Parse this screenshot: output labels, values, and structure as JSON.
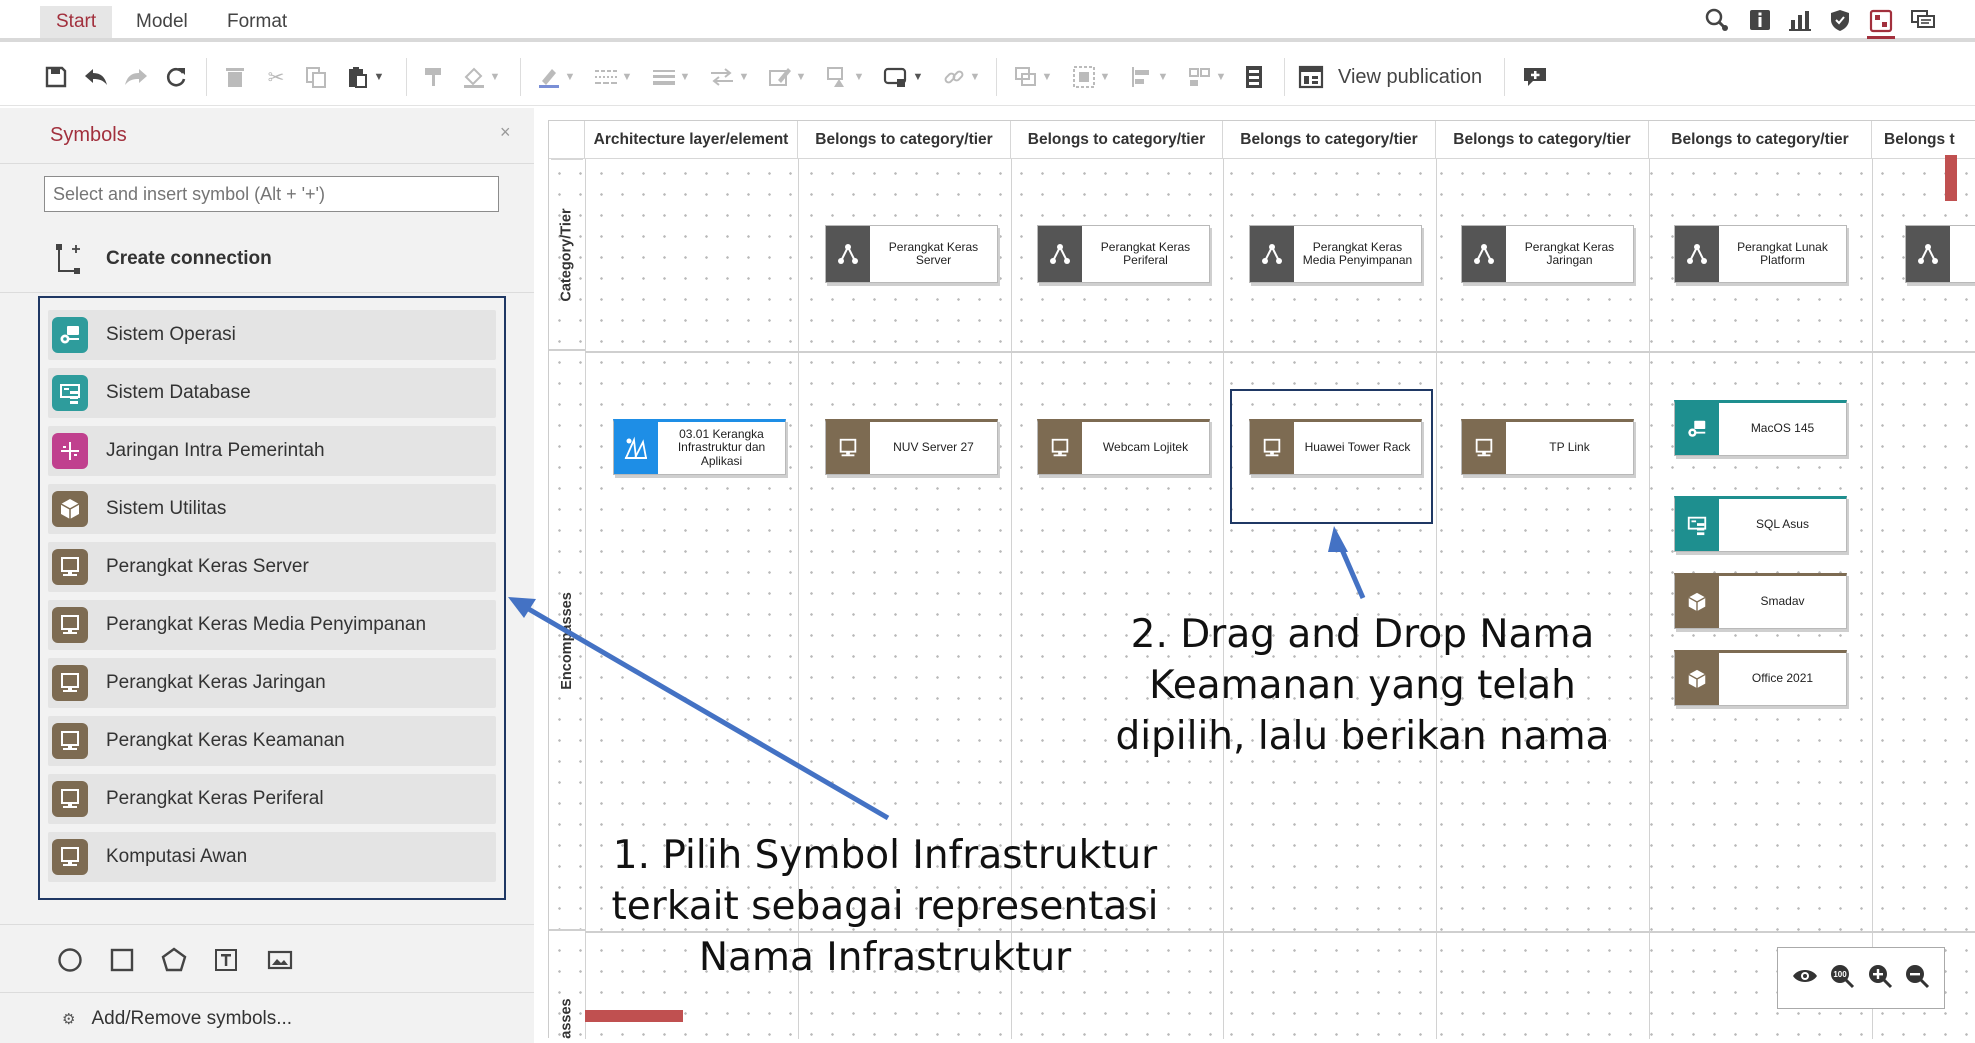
{
  "menubar": {
    "tabs": [
      {
        "label": "Start",
        "active": true
      },
      {
        "label": "Model",
        "active": false
      },
      {
        "label": "Format",
        "active": false
      }
    ],
    "right_icons": [
      "search-settings-icon",
      "info-icon",
      "bar-chart-icon",
      "shield-icon",
      "symbols-panel-icon",
      "comments-icon"
    ]
  },
  "toolbar": {
    "view_publication_label": "View publication"
  },
  "symbols_panel": {
    "title": "Symbols",
    "close_glyph": "×",
    "search_placeholder": "Select and insert symbol (Alt + '+')",
    "create_connection_label": "Create connection",
    "items": [
      {
        "label": "Sistem Operasi",
        "icon": "operating-system-icon",
        "color": "#2e9c9c"
      },
      {
        "label": "Sistem Database",
        "icon": "database-system-icon",
        "color": "#2e9c9c"
      },
      {
        "label": "Jaringan Intra Pemerintah",
        "icon": "network-icon",
        "color": "#c0408e"
      },
      {
        "label": "Sistem Utilitas",
        "icon": "utility-cube-icon",
        "color": "#7d6b52"
      },
      {
        "label": "Perangkat Keras Server",
        "icon": "monitor-icon",
        "color": "#7d6b52"
      },
      {
        "label": "Perangkat Keras Media Penyimpanan",
        "icon": "monitor-icon",
        "color": "#7d6b52"
      },
      {
        "label": "Perangkat Keras Jaringan",
        "icon": "monitor-icon",
        "color": "#7d6b52"
      },
      {
        "label": "Perangkat Keras Keamanan",
        "icon": "monitor-icon",
        "color": "#7d6b52"
      },
      {
        "label": "Perangkat Keras Periferal",
        "icon": "monitor-icon",
        "color": "#7d6b52"
      },
      {
        "label": "Komputasi Awan",
        "icon": "monitor-icon",
        "color": "#7d6b52"
      }
    ],
    "shape_icons": [
      "circle-shape-icon",
      "square-shape-icon",
      "pentagon-shape-icon",
      "text-shape-icon",
      "image-shape-icon"
    ],
    "add_remove_label": "Add/Remove symbols..."
  },
  "canvas": {
    "column_headers": [
      "Architecture layer/element",
      "Belongs to category/tier",
      "Belongs to category/tier",
      "Belongs to category/tier",
      "Belongs to category/tier",
      "Belongs to category/tier",
      "Belongs t"
    ],
    "row_labels": [
      "Category/Tier",
      "Encompasses",
      "passes"
    ],
    "category_nodes": [
      "Perangkat Keras Server",
      "Perangkat Keras Periferal",
      "Perangkat Keras Media Penyimpanan",
      "Perangkat Keras Jaringan",
      "Perangkat Lunak Platform"
    ],
    "element_nodes": [
      {
        "label": "03.01 Kerangka Infrastruktur dan Aplikasi",
        "color": "#1e8ee6"
      },
      {
        "label": "NUV Server 27",
        "color": "#7d6b52"
      },
      {
        "label": "Webcam Lojitek",
        "color": "#7d6b52"
      },
      {
        "label": "Huawei Tower Rack",
        "color": "#7d6b52"
      },
      {
        "label": "TP Link",
        "color": "#7d6b52"
      },
      {
        "label": "MacOS 145",
        "color": "#1e8f8f"
      },
      {
        "label": "SQL Asus",
        "color": "#1e8f8f"
      },
      {
        "label": "Smadav",
        "color": "#7d6b52"
      },
      {
        "label": "Office 2021",
        "color": "#7d6b52"
      }
    ],
    "zoom_icons": [
      "eye-icon",
      "zoom-100-icon",
      "zoom-in-icon",
      "zoom-out-icon"
    ]
  },
  "annotations": {
    "step1": [
      "1. Pilih Symbol Infrastruktur",
      "terkait sebagai representasi",
      "Nama Infrastruktur"
    ],
    "step2": [
      "2. Drag and Drop Nama",
      "Keamanan yang telah",
      "dipilih, lalu berikan nama"
    ]
  },
  "colors": {
    "accent": "#a2303d",
    "annotation_blue": "#4472c4",
    "highlight_border": "#1f3864",
    "category_icon": "#555555"
  }
}
